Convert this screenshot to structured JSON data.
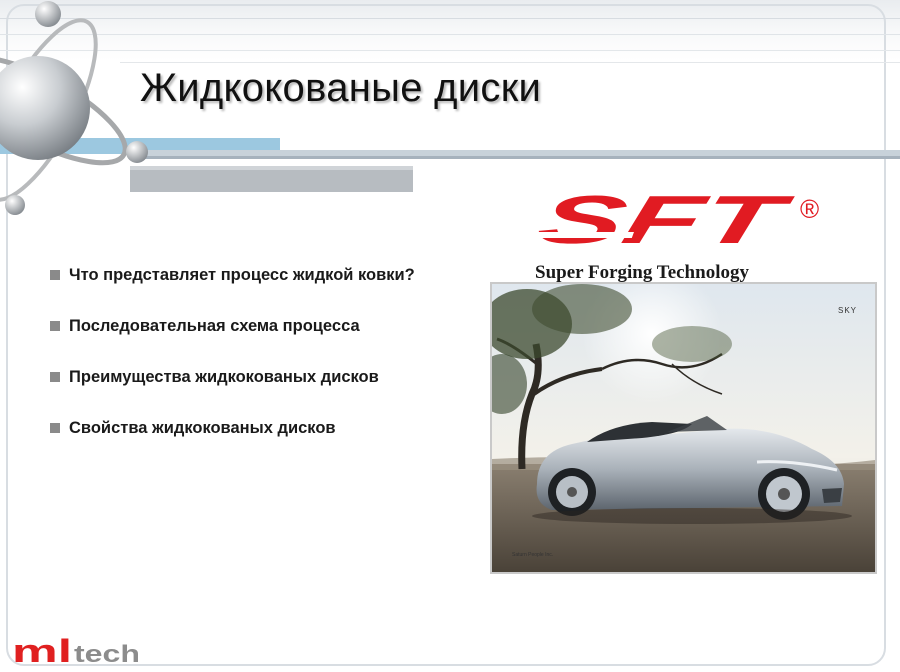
{
  "slide": {
    "title": "Жидкокованые диски",
    "bullets": [
      "Что представляет процесс жидкой ковки?",
      "Последовательная схема процесса",
      "Преимущества жидкокованых дисков",
      "Свойства жидкокованых дисков"
    ]
  },
  "sft_logo": {
    "mark": "SFT",
    "registered": "®",
    "subtitle": "Super Forging Technology"
  },
  "photo": {
    "brand": "SKY",
    "caption": "Saturn People Inc."
  },
  "footer_logo": {
    "ml": "ml",
    "tech": "tech"
  },
  "colors": {
    "sft_red": "#e11b22",
    "mltech_red": "#e02020",
    "mltech_gray": "#8c8c8c",
    "accent_blue": "#9cc8e0"
  },
  "icons": [
    "atom-icon",
    "bullet-square-icon"
  ]
}
